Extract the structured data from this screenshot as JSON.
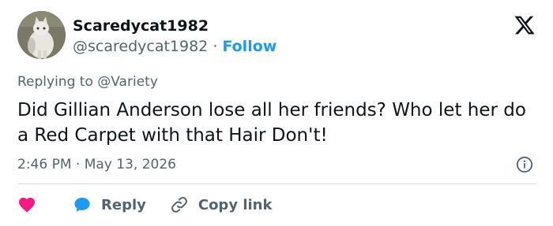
{
  "user": {
    "display_name": "Scaredycat1982",
    "handle": "@scaredycat1982",
    "separator": "·",
    "follow_label": "Follow"
  },
  "reply_context": {
    "prefix": "Replying to",
    "mention": "@Variety"
  },
  "tweet": {
    "text": "Did Gillian Anderson lose all her friends? Who let her do a Red Carpet with that Hair Don't!",
    "timestamp": "2:46 PM · May 13, 2026"
  },
  "actions": {
    "reply_label": "Reply",
    "copy_link_label": "Copy link"
  },
  "icons": {
    "logo": "x-logo-icon",
    "info": "info-icon",
    "like": "heart-icon",
    "reply": "reply-bubble-icon",
    "copy": "link-icon"
  },
  "colors": {
    "accent": "#1d9bf0",
    "like": "#f91880",
    "secondary_text": "#536471",
    "primary_text": "#0f1419"
  }
}
